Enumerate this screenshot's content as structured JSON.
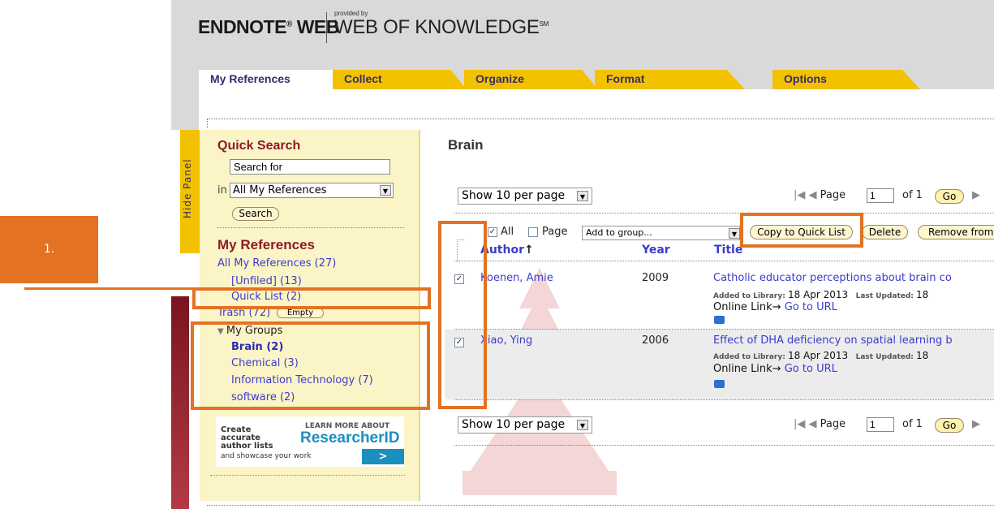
{
  "brand": {
    "endnote": "ENDNOTE",
    "reg": "®",
    "web": " WEB",
    "provided_by": "provided by",
    "wok": "WEB OF KNOWLEDGE",
    "sm": "SM"
  },
  "tabs": [
    {
      "label": "My References"
    },
    {
      "label": "Collect"
    },
    {
      "label": "Organize"
    },
    {
      "label": "Format"
    },
    {
      "label": "Options"
    }
  ],
  "side_panel": {
    "hide_panel": "Hide Panel",
    "quick_search_title": "Quick Search",
    "search_value": "Search for",
    "in_label": "in",
    "scope_value": "All My References",
    "search_button": "Search",
    "my_refs_title": "My References",
    "all_refs": "All My References (27)",
    "unfiled": "[Unfiled] (13)",
    "quick_list": "Quick List (2)",
    "trash": "Trash (72)",
    "empty_button": "Empty",
    "my_groups": "My Groups",
    "groups": [
      {
        "label": "Brain  (2)"
      },
      {
        "label": "Chemical  (3)"
      },
      {
        "label": "Information Technology  (7)"
      },
      {
        "label": "software  (2)"
      }
    ]
  },
  "ad": {
    "line1": "Create",
    "line2": "accurate",
    "line3": "author lists",
    "line4": "and showcase your work",
    "learn": "LEARN MORE ABOUT",
    "product": "ResearcherID",
    "go": ">"
  },
  "main": {
    "title": "Brain",
    "show_per_page": "Show 10 per page",
    "page_label": "Page",
    "page_value": "1",
    "of_label": "of 1",
    "go_label": "Go",
    "select_all": "All",
    "select_page": "Page",
    "add_to_group": "Add to group...",
    "copy_quick_list": "Copy to Quick List",
    "delete": "Delete",
    "remove_from": "Remove from",
    "col_author": "Author",
    "col_year": "Year",
    "col_title": "Title",
    "sort_arrow": "↑"
  },
  "references": [
    {
      "author": "Koenen, Amie",
      "year": "2009",
      "title": "Catholic educator perceptions about brain co",
      "added_label": "Added to Library:",
      "added": "18 Apr 2013",
      "updated_label": "Last Updated:",
      "updated": "18",
      "online_link": "Online Link→",
      "go_url": "Go to URL"
    },
    {
      "author": "Xiao, Ying",
      "year": "2006",
      "title": "Effect of DHA deficiency on spatial learning b",
      "added_label": "Added to Library:",
      "added": "18 Apr 2013",
      "updated_label": "Last Updated:",
      "updated": "18",
      "online_link": "Online Link→",
      "go_url": "Go to URL"
    }
  ],
  "annotation": {
    "step": "1."
  },
  "colors": {
    "accent": "#e37222",
    "tab": "#f2c200",
    "link": "#3b3bcc",
    "heading": "#8b1a2b",
    "panel": "#fbf4c6"
  }
}
